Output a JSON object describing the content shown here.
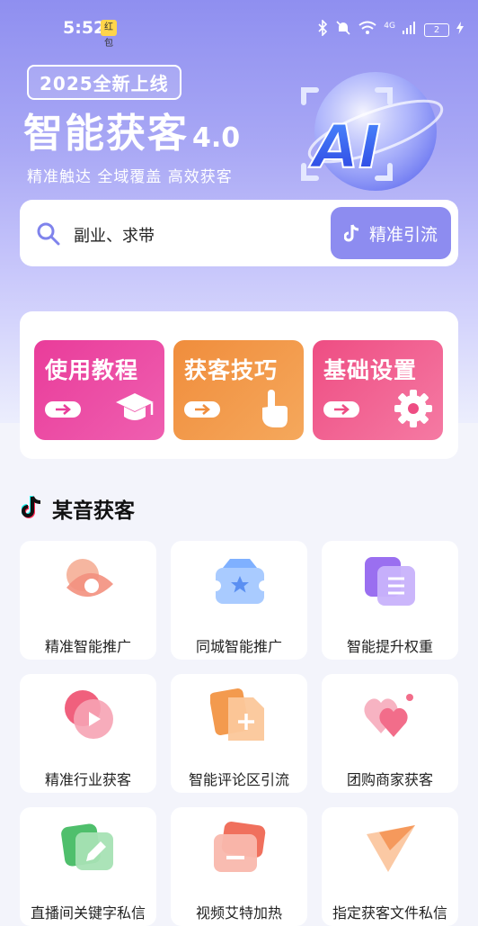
{
  "status": {
    "time": "5:52",
    "app_icon": "红包",
    "network": "4G",
    "battery": "2"
  },
  "hero": {
    "badge": "2025全新上线",
    "title": "智能获客",
    "version": "4.0",
    "subtitle": "精准触达 全域覆盖 高效获客",
    "orb_text": "AI"
  },
  "search": {
    "value": "副业、求带",
    "button_label": "精准引流"
  },
  "quick_actions": [
    {
      "label": "使用教程",
      "icon": "graduation-cap-icon"
    },
    {
      "label": "获客技巧",
      "icon": "pointer-hand-icon"
    },
    {
      "label": "基础设置",
      "icon": "gear-icon"
    }
  ],
  "section": {
    "title": "某音获客"
  },
  "features": [
    {
      "label": "精准智能推广",
      "icon": "eye-icon",
      "color": "#f3907e"
    },
    {
      "label": "同城智能推广",
      "icon": "ticket-star-icon",
      "color": "#5a8ff2"
    },
    {
      "label": "智能提升权重",
      "icon": "document-list-icon",
      "color": "#9a6ff0"
    },
    {
      "label": "精准行业获客",
      "icon": "play-icon",
      "color": "#f0607d"
    },
    {
      "label": "智能评论区引流",
      "icon": "file-plus-icon",
      "color": "#f39a4e"
    },
    {
      "label": "团购商家获客",
      "icon": "hearts-icon",
      "color": "#f26d8a"
    },
    {
      "label": "直播间关键字私信",
      "icon": "edit-pen-icon",
      "color": "#4fbf6c"
    },
    {
      "label": "视频艾特加热",
      "icon": "minus-card-icon",
      "color": "#f0705d"
    },
    {
      "label": "指定获客文件私信",
      "icon": "send-icon",
      "color": "#f5995c"
    }
  ]
}
